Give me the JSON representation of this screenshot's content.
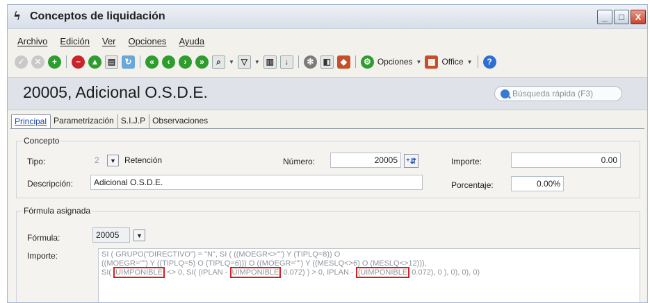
{
  "window": {
    "title": "Conceptos de liquidación",
    "controls": [
      "_",
      "□",
      "X"
    ]
  },
  "menu": [
    "Archivo",
    "Edición",
    "Ver",
    "Opciones",
    "Ayuda"
  ],
  "toolbar": {
    "opciones_label": "Opciones",
    "office_label": "Office"
  },
  "header": {
    "title": "20005, Adicional O.S.D.E.",
    "search_placeholder": "Búsqueda rápida (F3)"
  },
  "tabs": [
    "Principal",
    "Parametrización",
    "S.I.J.P",
    "Observaciones"
  ],
  "concepto": {
    "legend": "Concepto",
    "tipo_label": "Tipo:",
    "tipo_value": "2",
    "tipo_text": "Retención",
    "numero_label": "Número:",
    "numero_value": "20005",
    "importe_label": "Importe:",
    "importe_value": "0.00",
    "descripcion_label": "Descripción:",
    "descripcion_value": "Adicional O.S.D.E.",
    "porcentaje_label": "Porcentaje:",
    "porcentaje_value": "0.00%"
  },
  "formula": {
    "legend": "Fórmula asignada",
    "formula_label": "Fórmula:",
    "formula_value": "20005",
    "importe_label": "Importe:",
    "line1": "SI ( GRUPO(\"DIRECTIVO\") = \"N\", SI ( ((MOEGR<>\"\") Y (TIPLQ=8)) O",
    "line2": "((MOEGR=\"\") Y ((TIPLQ=5) O (TIPLQ=6))) O ((MOEGR=\"\") Y ((MESLQ<>6) O (MESLQ<>12))),",
    "line3_a": "SI(",
    "line3_hl1": "UIMPONIBLE",
    "line3_b": "<> 0, SI( (IPLAN -",
    "line3_hl2": "UIMPONIBLE",
    "line3_c": "0.072) ) > 0, IPLAN -",
    "line3_hl3": "(UIMPONIBLE",
    "line3_d": "0.072), 0 ), 0), 0), 0)"
  }
}
